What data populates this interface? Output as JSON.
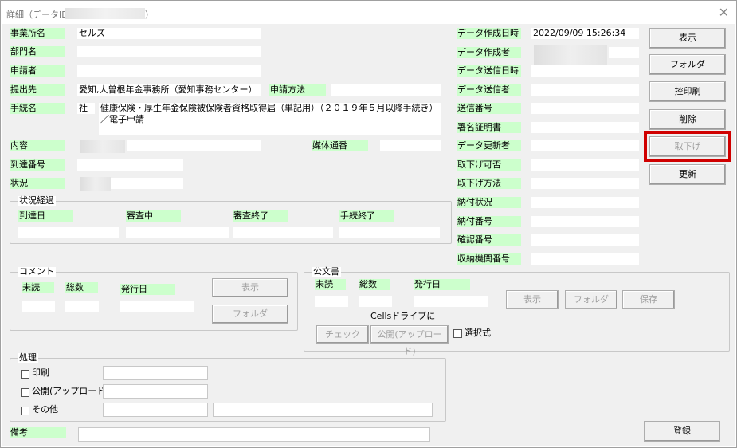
{
  "window": {
    "title": "詳細（データID",
    "title_suffix": "）",
    "close_icon": "close-icon"
  },
  "left": {
    "jigyosho_label": "事業所名",
    "jigyosho_value": "セルズ",
    "bumon_label": "部門名",
    "shinseisha_label": "申請者",
    "teishutsu_label": "提出先",
    "teishutsu_value": "愛知,大曽根年金事務所（愛知事務センター）",
    "shinsei_hoho_label": "申請方法",
    "tetsuzuki_label": "手続名",
    "tetsuzuki_code": "社",
    "tetsuzuki_value": "健康保険・厚生年金保険被保険者資格取得届（単記用）（２０１９年５月以降手続き）／電子申請",
    "naiyo_label": "内容",
    "baitai_label": "媒体通番",
    "totatsu_label": "到達番号",
    "jokyo_label": "状況"
  },
  "progress": {
    "caption": "状況経過",
    "cols": [
      "到達日",
      "審査中",
      "審査終了",
      "手続終了"
    ]
  },
  "right": {
    "labels": [
      "データ作成日時",
      "データ作成者",
      "データ送信日時",
      "データ送信者",
      "送信番号",
      "署名証明書",
      "データ更新者",
      "取下げ可否",
      "取下げ方法",
      "納付状況",
      "納付番号",
      "確認番号",
      "収納機関番号"
    ],
    "created_at": "2022/09/09 15:26:34"
  },
  "buttons": {
    "display": "表示",
    "folder": "フォルダ",
    "hikae_print": "控印刷",
    "delete": "削除",
    "torisage": "取下げ",
    "update": "更新",
    "register": "登録"
  },
  "comment": {
    "caption": "コメント",
    "unread": "未読",
    "total": "総数",
    "issue_date": "発行日",
    "display": "表示",
    "folder": "フォルダ"
  },
  "kobunsho": {
    "caption": "公文書",
    "unread": "未読",
    "total": "総数",
    "issue_date": "発行日",
    "display": "表示",
    "folder": "フォルダ",
    "save": "保存",
    "cells_drive": "Cellsドライブに",
    "check": "チェック",
    "publish": "公開(アップロード)",
    "select": "選択式"
  },
  "processing": {
    "caption": "処理",
    "print": "印刷",
    "publish": "公開(アップロード)",
    "other": "その他"
  },
  "biko_label": "備考",
  "colors": {
    "label_bg": "#ccffcc",
    "panel_bg": "#f0f0f0",
    "highlight": "#d00000"
  }
}
